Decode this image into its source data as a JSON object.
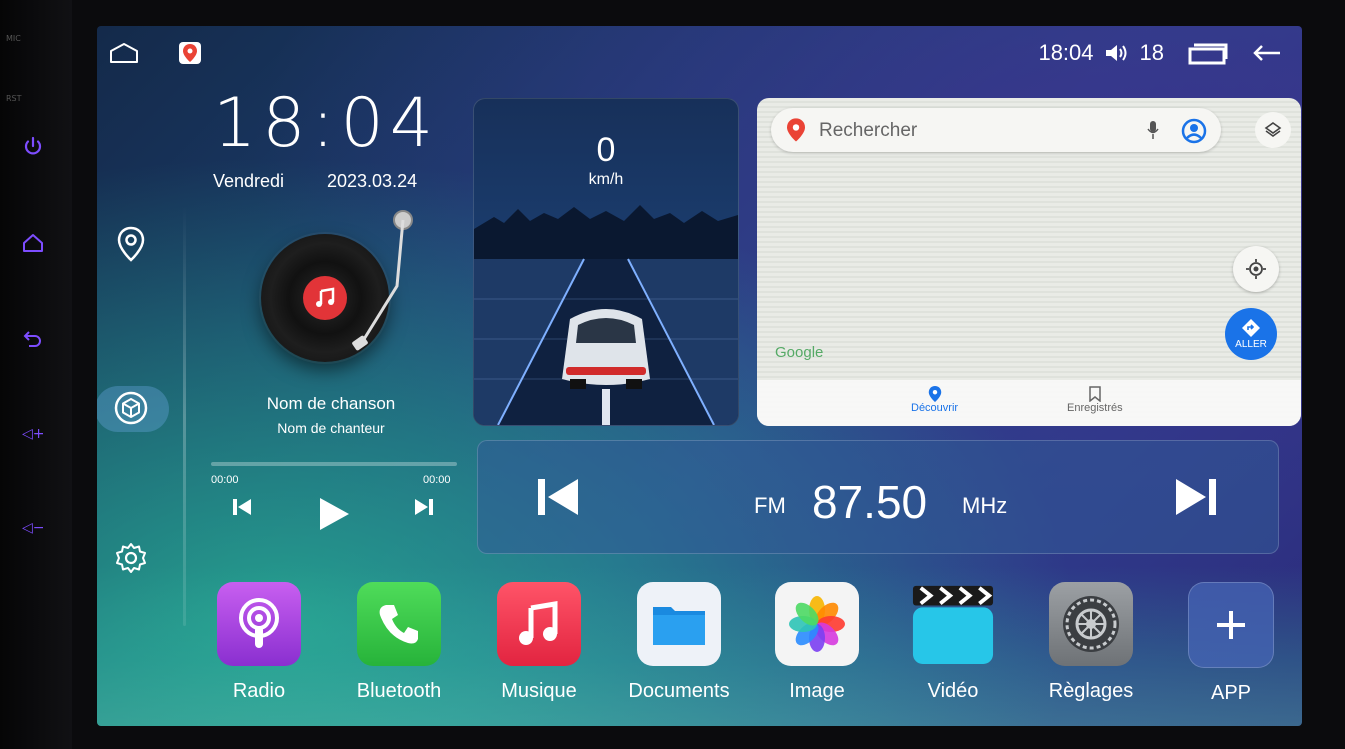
{
  "bezel": {
    "mic_label": "MIC",
    "rst_label": "RST",
    "vol_up_label": "◁+",
    "vol_down_label": "◁−"
  },
  "status_bar": {
    "time": "18:04",
    "volume": "18"
  },
  "clock_widget": {
    "time": "18:04",
    "weekday": "Vendredi",
    "date": "2023.03.24"
  },
  "music_widget": {
    "song_title": "Nom de chanson",
    "artist": "Nom de chanteur",
    "elapsed": "00:00",
    "duration": "00:00",
    "progress": 0
  },
  "speed_widget": {
    "value": "0",
    "unit": "km/h"
  },
  "map_widget": {
    "search_placeholder": "Rechercher",
    "logo": "Google",
    "go_label": "ALLER",
    "tabs": [
      {
        "label": "Découvrir"
      },
      {
        "label": "Enregistrés"
      }
    ]
  },
  "radio_widget": {
    "band": "FM",
    "frequency": "87.50",
    "unit": "MHz"
  },
  "dock": [
    {
      "label": "Radio",
      "icon": "podcast-icon",
      "color": "#b04fe0"
    },
    {
      "label": "Bluetooth",
      "icon": "phone-icon",
      "color": "#36c24a"
    },
    {
      "label": "Musique",
      "icon": "music-note-icon",
      "color": "#f0344c"
    },
    {
      "label": "Documents",
      "icon": "folder-icon",
      "color": "#e8eef6"
    },
    {
      "label": "Image",
      "icon": "photos-icon",
      "color": "#f2f2f2"
    },
    {
      "label": "Vidéo",
      "icon": "clapperboard-icon",
      "color": "#27c6e8"
    },
    {
      "label": "Règlages",
      "icon": "settings-gear-icon",
      "color": "#8e9296"
    },
    {
      "label": "APP",
      "icon": "plus-icon",
      "color": "#3f5faa"
    }
  ]
}
